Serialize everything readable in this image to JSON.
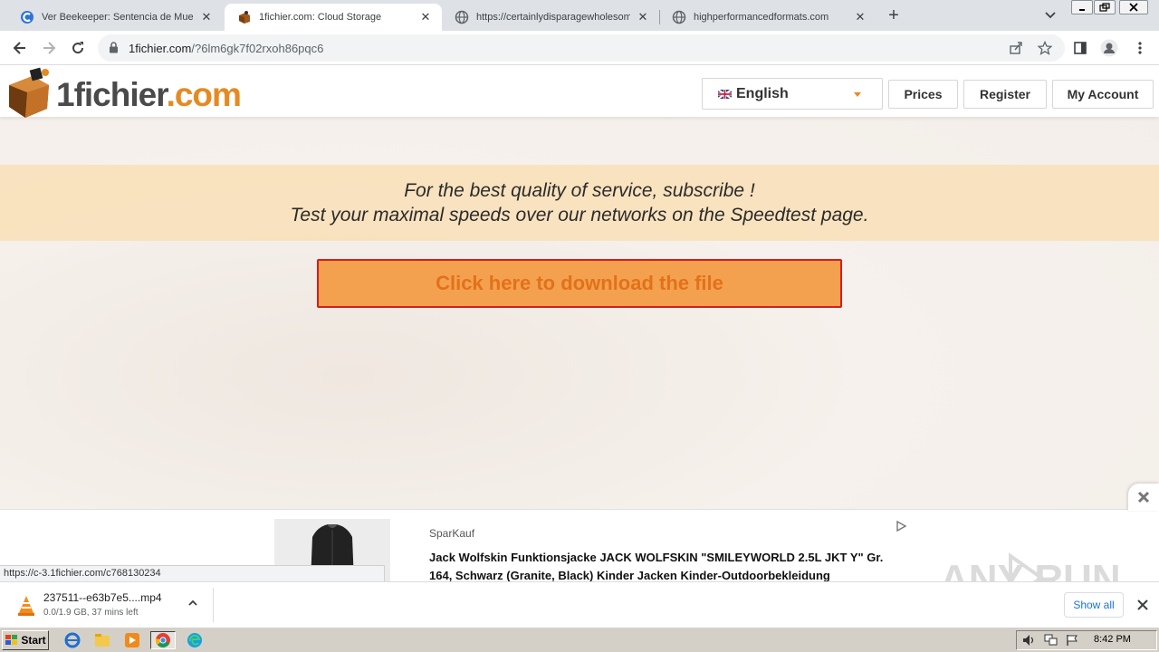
{
  "browser": {
    "tabs": [
      {
        "title": "Ver Beekeeper: Sentencia de Muerte",
        "favicon": "cuevana-icon",
        "active": false
      },
      {
        "title": "1fichier.com: Cloud Storage",
        "favicon": "1fichier-icon",
        "active": true
      },
      {
        "title": "https://certainlydisparagewholesome",
        "favicon": "globe-icon",
        "active": false
      },
      {
        "title": "highperformancedformats.com",
        "favicon": "globe-icon",
        "active": false
      }
    ],
    "url_host": "1fichier.com",
    "url_path": "/?6lm6gk7f02rxoh86pqc6"
  },
  "site": {
    "logo_part1": "1fichier",
    "logo_part2": ".com",
    "language": "English",
    "nav": {
      "prices": "Prices",
      "register": "Register",
      "my_account": "My Account"
    },
    "promo_line1": "For the best quality of service, subscribe !",
    "promo_line2": "Test your maximal speeds over our networks on the Speedtest page.",
    "download_button": "Click here to download the file"
  },
  "ad": {
    "brand": "SparKauf",
    "title": "Jack Wolfskin Funktionsjacke JACK WOLFSKIN \"SMILEYWORLD 2.5L JKT Y\" Gr. 164, Schwarz (Granite, Black) Kinder Jacken Kinder-Outdoorbekleidung"
  },
  "status_url": "https://c-3.1fichier.com/c768130234",
  "download": {
    "filename": "237511--e63b7e5....mp4",
    "status": "0.0/1.9 GB, 37 mins left",
    "show_all": "Show all"
  },
  "taskbar": {
    "start": "Start",
    "clock": "8:42 PM"
  },
  "watermark": "ANY RUN",
  "colors": {
    "accent_orange": "#e58a22",
    "download_btn_bg": "#f4a14f",
    "download_btn_border": "#d81c1c",
    "promo_bg": "#fadeb0"
  }
}
